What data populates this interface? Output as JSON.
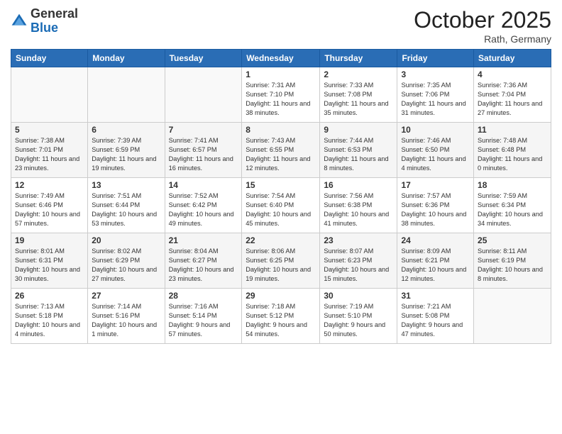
{
  "header": {
    "logo_line1": "General",
    "logo_line2": "Blue",
    "month": "October 2025",
    "location": "Rath, Germany"
  },
  "days_of_week": [
    "Sunday",
    "Monday",
    "Tuesday",
    "Wednesday",
    "Thursday",
    "Friday",
    "Saturday"
  ],
  "weeks": [
    [
      {
        "num": "",
        "sunrise": "",
        "sunset": "",
        "daylight": ""
      },
      {
        "num": "",
        "sunrise": "",
        "sunset": "",
        "daylight": ""
      },
      {
        "num": "",
        "sunrise": "",
        "sunset": "",
        "daylight": ""
      },
      {
        "num": "1",
        "sunrise": "Sunrise: 7:31 AM",
        "sunset": "Sunset: 7:10 PM",
        "daylight": "Daylight: 11 hours and 38 minutes."
      },
      {
        "num": "2",
        "sunrise": "Sunrise: 7:33 AM",
        "sunset": "Sunset: 7:08 PM",
        "daylight": "Daylight: 11 hours and 35 minutes."
      },
      {
        "num": "3",
        "sunrise": "Sunrise: 7:35 AM",
        "sunset": "Sunset: 7:06 PM",
        "daylight": "Daylight: 11 hours and 31 minutes."
      },
      {
        "num": "4",
        "sunrise": "Sunrise: 7:36 AM",
        "sunset": "Sunset: 7:04 PM",
        "daylight": "Daylight: 11 hours and 27 minutes."
      }
    ],
    [
      {
        "num": "5",
        "sunrise": "Sunrise: 7:38 AM",
        "sunset": "Sunset: 7:01 PM",
        "daylight": "Daylight: 11 hours and 23 minutes."
      },
      {
        "num": "6",
        "sunrise": "Sunrise: 7:39 AM",
        "sunset": "Sunset: 6:59 PM",
        "daylight": "Daylight: 11 hours and 19 minutes."
      },
      {
        "num": "7",
        "sunrise": "Sunrise: 7:41 AM",
        "sunset": "Sunset: 6:57 PM",
        "daylight": "Daylight: 11 hours and 16 minutes."
      },
      {
        "num": "8",
        "sunrise": "Sunrise: 7:43 AM",
        "sunset": "Sunset: 6:55 PM",
        "daylight": "Daylight: 11 hours and 12 minutes."
      },
      {
        "num": "9",
        "sunrise": "Sunrise: 7:44 AM",
        "sunset": "Sunset: 6:53 PM",
        "daylight": "Daylight: 11 hours and 8 minutes."
      },
      {
        "num": "10",
        "sunrise": "Sunrise: 7:46 AM",
        "sunset": "Sunset: 6:50 PM",
        "daylight": "Daylight: 11 hours and 4 minutes."
      },
      {
        "num": "11",
        "sunrise": "Sunrise: 7:48 AM",
        "sunset": "Sunset: 6:48 PM",
        "daylight": "Daylight: 11 hours and 0 minutes."
      }
    ],
    [
      {
        "num": "12",
        "sunrise": "Sunrise: 7:49 AM",
        "sunset": "Sunset: 6:46 PM",
        "daylight": "Daylight: 10 hours and 57 minutes."
      },
      {
        "num": "13",
        "sunrise": "Sunrise: 7:51 AM",
        "sunset": "Sunset: 6:44 PM",
        "daylight": "Daylight: 10 hours and 53 minutes."
      },
      {
        "num": "14",
        "sunrise": "Sunrise: 7:52 AM",
        "sunset": "Sunset: 6:42 PM",
        "daylight": "Daylight: 10 hours and 49 minutes."
      },
      {
        "num": "15",
        "sunrise": "Sunrise: 7:54 AM",
        "sunset": "Sunset: 6:40 PM",
        "daylight": "Daylight: 10 hours and 45 minutes."
      },
      {
        "num": "16",
        "sunrise": "Sunrise: 7:56 AM",
        "sunset": "Sunset: 6:38 PM",
        "daylight": "Daylight: 10 hours and 41 minutes."
      },
      {
        "num": "17",
        "sunrise": "Sunrise: 7:57 AM",
        "sunset": "Sunset: 6:36 PM",
        "daylight": "Daylight: 10 hours and 38 minutes."
      },
      {
        "num": "18",
        "sunrise": "Sunrise: 7:59 AM",
        "sunset": "Sunset: 6:34 PM",
        "daylight": "Daylight: 10 hours and 34 minutes."
      }
    ],
    [
      {
        "num": "19",
        "sunrise": "Sunrise: 8:01 AM",
        "sunset": "Sunset: 6:31 PM",
        "daylight": "Daylight: 10 hours and 30 minutes."
      },
      {
        "num": "20",
        "sunrise": "Sunrise: 8:02 AM",
        "sunset": "Sunset: 6:29 PM",
        "daylight": "Daylight: 10 hours and 27 minutes."
      },
      {
        "num": "21",
        "sunrise": "Sunrise: 8:04 AM",
        "sunset": "Sunset: 6:27 PM",
        "daylight": "Daylight: 10 hours and 23 minutes."
      },
      {
        "num": "22",
        "sunrise": "Sunrise: 8:06 AM",
        "sunset": "Sunset: 6:25 PM",
        "daylight": "Daylight: 10 hours and 19 minutes."
      },
      {
        "num": "23",
        "sunrise": "Sunrise: 8:07 AM",
        "sunset": "Sunset: 6:23 PM",
        "daylight": "Daylight: 10 hours and 15 minutes."
      },
      {
        "num": "24",
        "sunrise": "Sunrise: 8:09 AM",
        "sunset": "Sunset: 6:21 PM",
        "daylight": "Daylight: 10 hours and 12 minutes."
      },
      {
        "num": "25",
        "sunrise": "Sunrise: 8:11 AM",
        "sunset": "Sunset: 6:19 PM",
        "daylight": "Daylight: 10 hours and 8 minutes."
      }
    ],
    [
      {
        "num": "26",
        "sunrise": "Sunrise: 7:13 AM",
        "sunset": "Sunset: 5:18 PM",
        "daylight": "Daylight: 10 hours and 4 minutes."
      },
      {
        "num": "27",
        "sunrise": "Sunrise: 7:14 AM",
        "sunset": "Sunset: 5:16 PM",
        "daylight": "Daylight: 10 hours and 1 minute."
      },
      {
        "num": "28",
        "sunrise": "Sunrise: 7:16 AM",
        "sunset": "Sunset: 5:14 PM",
        "daylight": "Daylight: 9 hours and 57 minutes."
      },
      {
        "num": "29",
        "sunrise": "Sunrise: 7:18 AM",
        "sunset": "Sunset: 5:12 PM",
        "daylight": "Daylight: 9 hours and 54 minutes."
      },
      {
        "num": "30",
        "sunrise": "Sunrise: 7:19 AM",
        "sunset": "Sunset: 5:10 PM",
        "daylight": "Daylight: 9 hours and 50 minutes."
      },
      {
        "num": "31",
        "sunrise": "Sunrise: 7:21 AM",
        "sunset": "Sunset: 5:08 PM",
        "daylight": "Daylight: 9 hours and 47 minutes."
      },
      {
        "num": "",
        "sunrise": "",
        "sunset": "",
        "daylight": ""
      }
    ]
  ]
}
